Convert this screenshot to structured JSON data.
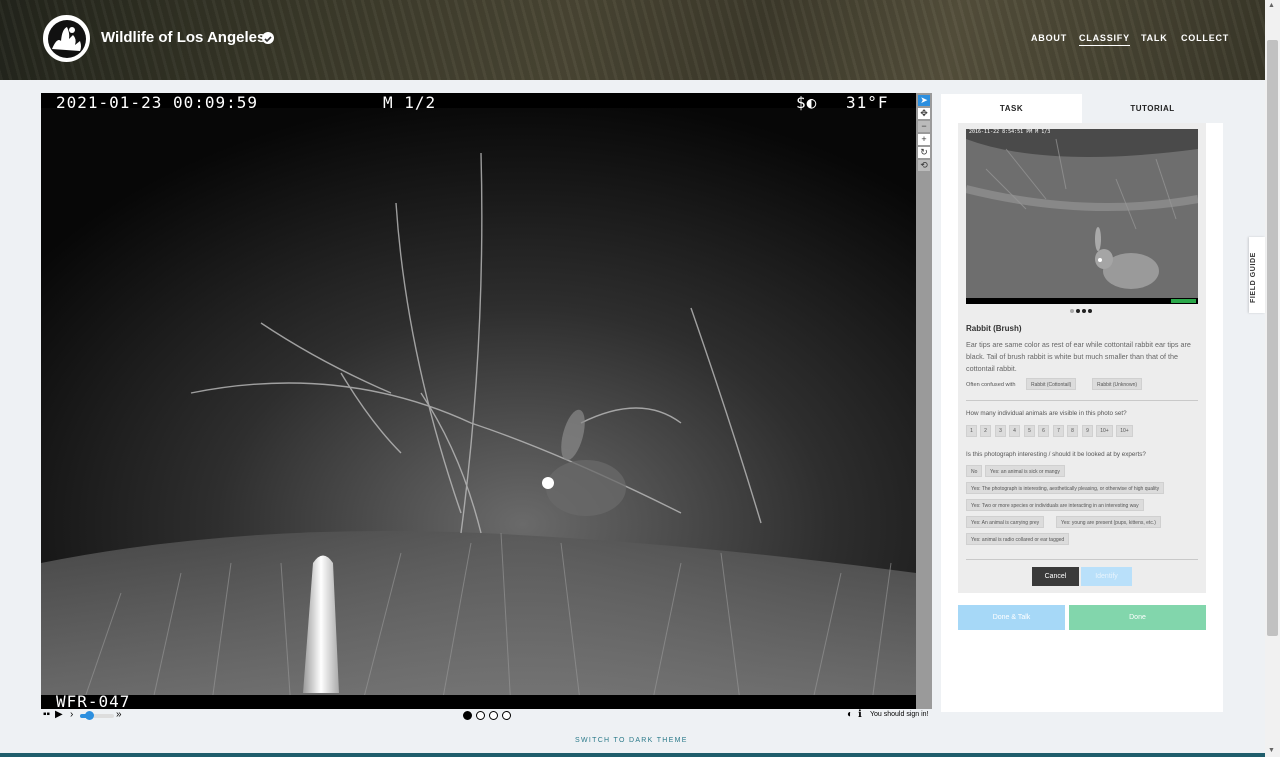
{
  "header": {
    "title": "Wildlife of Los Angeles",
    "nav": [
      "ABOUT",
      "CLASSIFY",
      "TALK",
      "COLLECT"
    ]
  },
  "subject": {
    "timestamp": "2021-01-23 00:09:59",
    "frame": "M 1/2",
    "temperature": "31°F",
    "camera_id": "WFR-047"
  },
  "controls": {
    "sign_in": "You should sign in!"
  },
  "footer": {
    "theme_link": "SWITCH TO DARK THEME"
  },
  "tabs": {
    "task": "TASK",
    "tutorial": "TUTORIAL"
  },
  "field_guide": "FIELD GUIDE",
  "species": {
    "name": "Rabbit (Brush)",
    "description": "Ear tips are same color as rest of ear while cottontail rabbit ear tips are black. Tail of brush rabbit is white but much smaller than that of the cottontail rabbit.",
    "confused_label": "Often confused with",
    "confused": [
      "Rabbit (Cottontail)",
      "Rabbit (Unknown)"
    ],
    "example_caption": "2016-11-22 8:54:51 PM  M 1/3"
  },
  "questions": {
    "count_q": "How many individual animals are visible in this photo set?",
    "count_options": [
      "1",
      "2",
      "3",
      "4",
      "5",
      "6",
      "7",
      "8",
      "9",
      "10+",
      "10+"
    ],
    "interesting_q": "Is this photograph interesting / should it be looked at by experts?",
    "interesting_options": [
      "No",
      "Yes: an animal is sick or mangy",
      "Yes: The photograph is interesting, aesthetically pleasing, or otherwise of high quality",
      "Yes: Two or more species or individuals are interacting in an interesting way",
      "Yes: An animal is carrying prey",
      "Yes: young are present (pups, kittens, etc.)",
      "Yes: animal is radio collared or ear tagged"
    ]
  },
  "buttons": {
    "cancel": "Cancel",
    "identify": "Identify",
    "done_talk": "Done & Talk",
    "done": "Done"
  }
}
